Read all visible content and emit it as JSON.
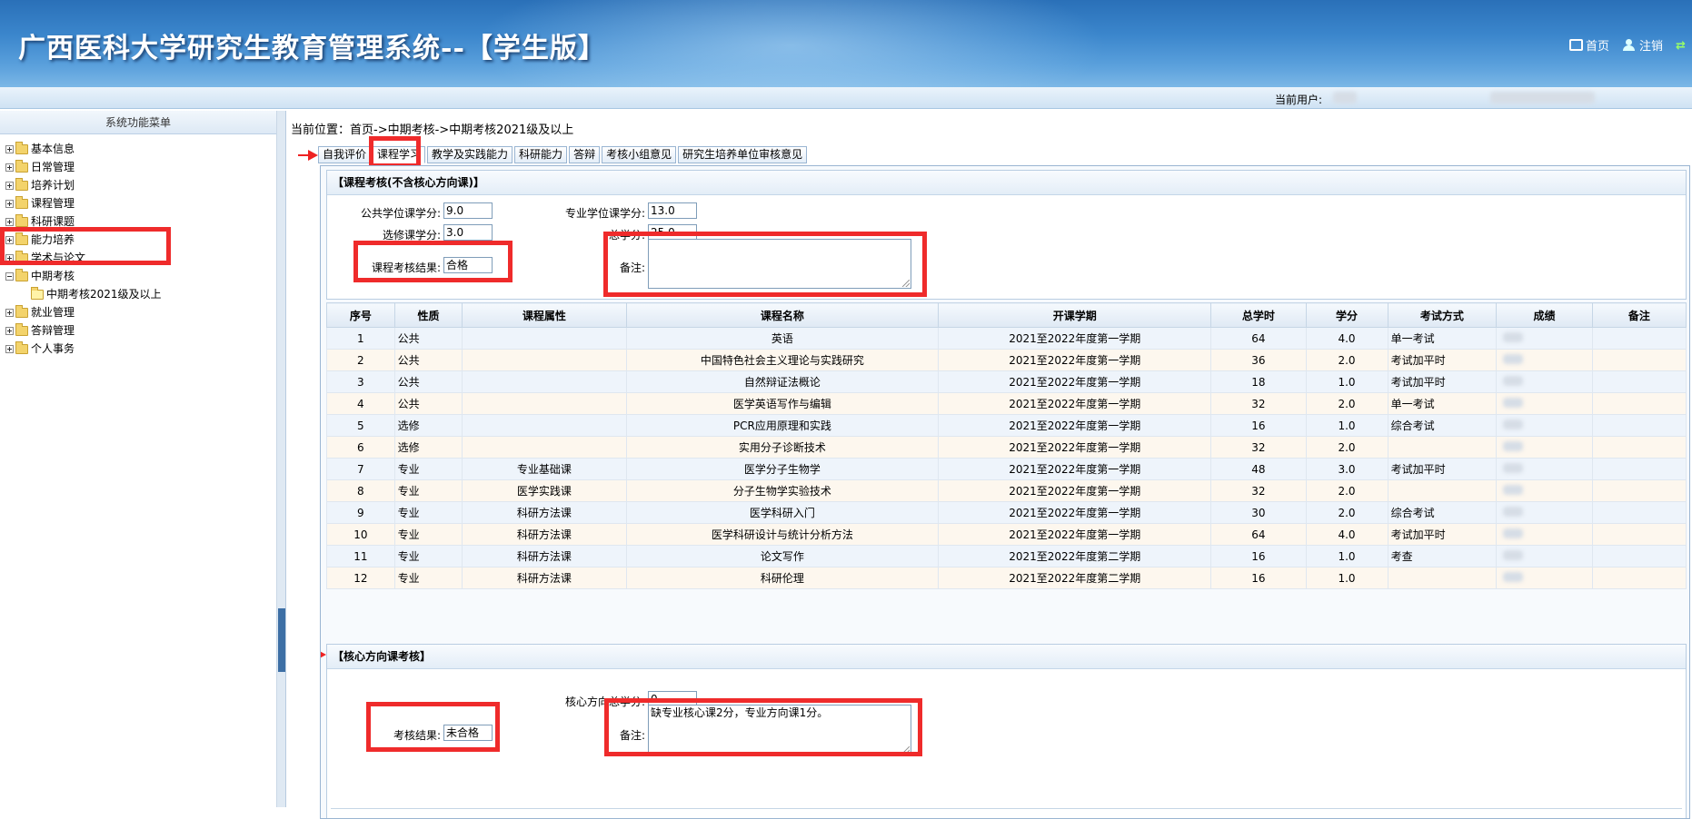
{
  "header": {
    "title": "广西医科大学研究生教育管理系统--【学生版】",
    "links": [
      "首页",
      "注销"
    ]
  },
  "userbar": {
    "label": "当前用户:"
  },
  "left_menu": {
    "title": "系统功能菜单",
    "items": [
      {
        "label": "基本信息",
        "expanded": false
      },
      {
        "label": "日常管理",
        "expanded": false
      },
      {
        "label": "培养计划",
        "expanded": false
      },
      {
        "label": "课程管理",
        "expanded": false
      },
      {
        "label": "科研课题",
        "expanded": false
      },
      {
        "label": "能力培养",
        "expanded": false
      },
      {
        "label": "学术与论文",
        "expanded": false
      },
      {
        "label": "中期考核",
        "expanded": true
      },
      {
        "label": "中期考核2021级及以上",
        "sub": true
      },
      {
        "label": "就业管理",
        "expanded": false
      },
      {
        "label": "答辩管理",
        "expanded": false
      },
      {
        "label": "个人事务",
        "expanded": false
      }
    ]
  },
  "breadcrumb": "当前位置：首页->中期考核->中期考核2021级及以上",
  "tabs": [
    "自我评价",
    "课程学习",
    "教学及实践能力",
    "科研能力",
    "答辩",
    "考核小组意见",
    "研究生培养单位审核意见"
  ],
  "active_tab": "课程学习",
  "course_section": {
    "title": "【课程考核(不含核心方向课)】",
    "public_credit_label": "公共学位课学分:",
    "public_credit": "9.0",
    "major_credit_label": "专业学位课学分:",
    "major_credit": "13.0",
    "elective_credit_label": "选修课学分:",
    "elective_credit": "3.0",
    "total_credit_label": "总学分:",
    "total_credit": "25.0",
    "result_label": "课程考核结果:",
    "result": "合格",
    "remark_label": "备注:",
    "remark": ""
  },
  "table": {
    "headers": [
      "序号",
      "性质",
      "课程属性",
      "课程名称",
      "开课学期",
      "总学时",
      "学分",
      "考试方式",
      "成绩",
      "备注"
    ],
    "rows": [
      [
        "1",
        "公共",
        "",
        "英语",
        "2021至2022年度第一学期",
        "64",
        "4.0",
        "单一考试"
      ],
      [
        "2",
        "公共",
        "",
        "中国特色社会主义理论与实践研究",
        "2021至2022年度第一学期",
        "36",
        "2.0",
        "考试加平时"
      ],
      [
        "3",
        "公共",
        "",
        "自然辩证法概论",
        "2021至2022年度第一学期",
        "18",
        "1.0",
        "考试加平时"
      ],
      [
        "4",
        "公共",
        "",
        "医学英语写作与编辑",
        "2021至2022年度第一学期",
        "32",
        "2.0",
        "单一考试"
      ],
      [
        "5",
        "选修",
        "",
        "PCR应用原理和实践",
        "2021至2022年度第一学期",
        "16",
        "1.0",
        "综合考试"
      ],
      [
        "6",
        "选修",
        "",
        "实用分子诊断技术",
        "2021至2022年度第一学期",
        "32",
        "2.0",
        ""
      ],
      [
        "7",
        "专业",
        "专业基础课",
        "医学分子生物学",
        "2021至2022年度第一学期",
        "48",
        "3.0",
        "考试加平时"
      ],
      [
        "8",
        "专业",
        "医学实践课",
        "分子生物学实验技术",
        "2021至2022年度第一学期",
        "32",
        "2.0",
        ""
      ],
      [
        "9",
        "专业",
        "科研方法课",
        "医学科研入门",
        "2021至2022年度第一学期",
        "30",
        "2.0",
        "综合考试"
      ],
      [
        "10",
        "专业",
        "科研方法课",
        "医学科研设计与统计分析方法",
        "2021至2022年度第一学期",
        "64",
        "4.0",
        "考试加平时"
      ],
      [
        "11",
        "专业",
        "科研方法课",
        "论文写作",
        "2021至2022年度第二学期",
        "16",
        "1.0",
        "考查"
      ],
      [
        "12",
        "专业",
        "科研方法课",
        "科研伦理",
        "2021至2022年度第二学期",
        "16",
        "1.0",
        ""
      ]
    ]
  },
  "core_section": {
    "title": "【核心方向课考核】",
    "total_credit_label": "核心方向总学分:",
    "total_credit": "0",
    "result_label": "考核结果:",
    "result": "未合格",
    "remark_label": "备注:",
    "remark": "缺专业核心课2分，专业方向课1分。"
  },
  "colors": {
    "accent_red": "#ef2b2b",
    "header_blue": "#3b86cc"
  }
}
